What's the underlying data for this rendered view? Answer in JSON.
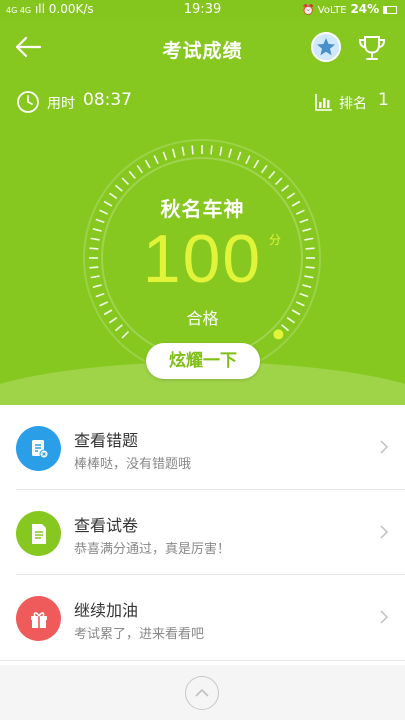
{
  "status_bar": {
    "network": "4G 4G",
    "signal": "ıll",
    "speed": "0.00K/s",
    "time": "19:39",
    "icons": "⏰ VoLTE",
    "battery": "24%"
  },
  "header": {
    "title": "考试成绩"
  },
  "stats": {
    "time_label": "用时",
    "time_value": "08:37",
    "rank_label": "排名",
    "rank_value": "1"
  },
  "result": {
    "level_title": "秋名车神",
    "score": "100",
    "score_unit": "分",
    "pass_label": "合格",
    "share_label": "炫耀一下",
    "gauge_fraction": 1.0
  },
  "actions": [
    {
      "title": "查看错题",
      "subtitle": "棒棒哒，没有错题哦",
      "icon": "wrong-answers-icon",
      "color": "#2a9fe8"
    },
    {
      "title": "查看试卷",
      "subtitle": "恭喜满分通过，真是厉害！",
      "icon": "exam-paper-icon",
      "color": "#86c81f"
    },
    {
      "title": "继续加油",
      "subtitle": "考试累了，进来看看吧",
      "icon": "gift-icon",
      "color": "#ef5a5a"
    }
  ],
  "colors": {
    "primary_green": "#86c81f",
    "score_yellow": "#e2f43a"
  }
}
